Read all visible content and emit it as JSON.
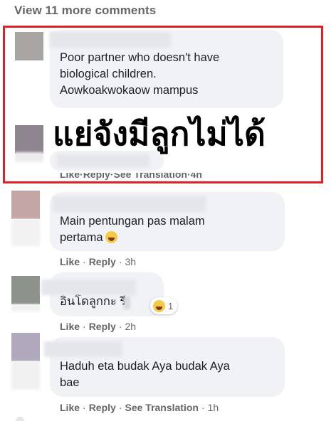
{
  "view_more": "View 11 more comments",
  "comments": [
    {
      "text": "Poor partner who doesn't have\nbiological children.\nAowkoakwokaow mampus",
      "avatar_color": "#a9a5a2"
    },
    {
      "overlay_text": "แย่จังมีลูกไม่ได้",
      "avatar_color": "#8f8591",
      "actions": [
        "Like",
        "Reply",
        "See Translation"
      ],
      "time": "4h"
    },
    {
      "text": "Main pentungan pas malam\npertama",
      "emoji": "laughing-face-icon",
      "avatar_color": "#c4a6a6",
      "actions": [
        "Like",
        "Reply"
      ],
      "time": "3h"
    },
    {
      "text": "อินโดลูกกะ  รี",
      "avatar_color": "#8e928c",
      "reaction": {
        "emoji": "laughing-face-icon",
        "count": "1"
      },
      "actions": [
        "Like",
        "Reply"
      ],
      "time": "2h"
    },
    {
      "text": "Haduh eta budak Aya budak Aya\nbae",
      "avatar_color": "#b0a9bd",
      "actions": [
        "Like",
        "Reply",
        "See Translation"
      ],
      "time": "1h"
    }
  ],
  "colors": {
    "highlight": "#e01f26",
    "bubble": "#f0f2f5",
    "meta_text": "#65676b"
  }
}
